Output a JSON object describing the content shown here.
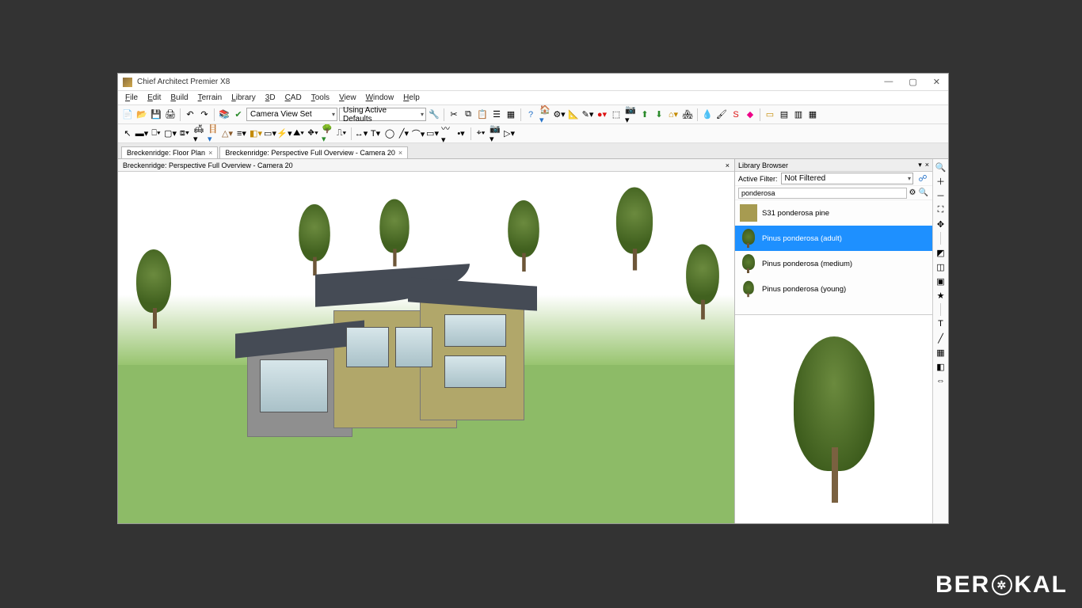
{
  "titlebar": {
    "title": "Chief Architect Premier X8"
  },
  "menu": [
    "File",
    "Edit",
    "Build",
    "Terrain",
    "Library",
    "3D",
    "CAD",
    "Tools",
    "View",
    "Window",
    "Help"
  ],
  "toolbar1": {
    "camera_combo": "Camera View Set",
    "defaults_combo": "Using Active Defaults"
  },
  "tabs": [
    {
      "label": "Breckenridge: Floor Plan"
    },
    {
      "label": "Breckenridge: Perspective Full Overview - Camera 20"
    }
  ],
  "viewport": {
    "subheader": "Breckenridge: Perspective Full Overview - Camera 20",
    "close": "×"
  },
  "library": {
    "title": "Library Browser",
    "filter_label": "Active Filter:",
    "filter_value": "Not Filtered",
    "search_value": "ponderosa",
    "items": [
      {
        "label": "S31 ponderosa pine",
        "kind": "swatch",
        "color": "#a79b51"
      },
      {
        "label": "Pinus ponderosa (adult)",
        "kind": "tree",
        "selected": true
      },
      {
        "label": "Pinus ponderosa (medium)",
        "kind": "tree"
      },
      {
        "label": "Pinus ponderosa (young)",
        "kind": "tree"
      }
    ]
  },
  "watermark": {
    "pre": "BER",
    "post": "KAL"
  }
}
